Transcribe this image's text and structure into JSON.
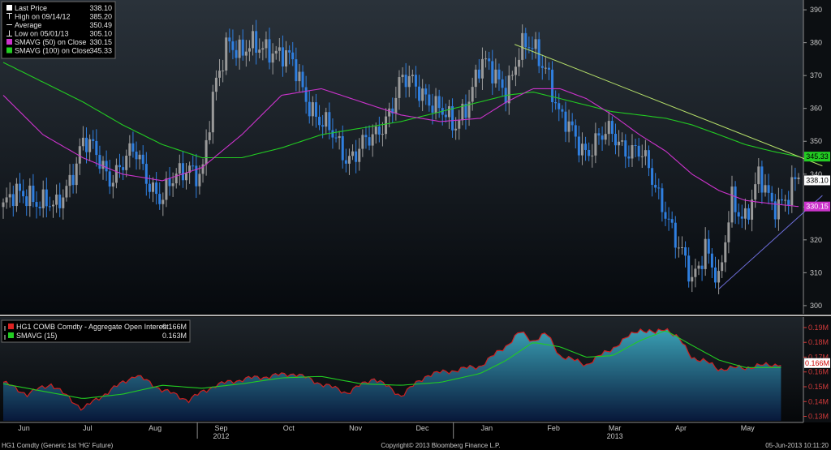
{
  "footer": {
    "left": "HG1 Comdty (Generic 1st 'HG' Future)",
    "center": "Copyright© 2013 Bloomberg Finance L.P.",
    "right": "05-Jun-2013 10:11:20"
  },
  "chart_data": [
    {
      "type": "line",
      "subtype": "candlestick",
      "xlabel": "",
      "ylabel": "",
      "ylim": [
        298,
        392
      ],
      "y_ticks": [
        300,
        310,
        320,
        330,
        340,
        350,
        360,
        370,
        380,
        390
      ],
      "x_ticks": [
        "Jun",
        "Jul",
        "Aug",
        "Sep",
        "Oct",
        "Nov",
        "Dec",
        "Jan",
        "Feb",
        "Mar",
        "Apr",
        "May"
      ],
      "year_labels": [
        "2012",
        "2013"
      ],
      "grid": false,
      "legend_position": "top-left",
      "colors": {
        "up": "#9a9a9a",
        "down": "#2f7fe0",
        "sma50": "#cc33cc",
        "sma100": "#22cc22",
        "trend_down": "#b6e06a",
        "trend_up": "#7070e0"
      },
      "legend": [
        {
          "label": "Last Price",
          "value": "338.10",
          "marker": "white-square"
        },
        {
          "label": "High on 09/14/12",
          "value": "385.20",
          "marker": "high-tick"
        },
        {
          "label": "Average",
          "value": "350.49",
          "marker": "dash"
        },
        {
          "label": "Low on 05/01/13",
          "value": "305.10",
          "marker": "low-tick"
        },
        {
          "label": "SMAVG (50) on Close",
          "value": "330.15",
          "marker": "magenta-square"
        },
        {
          "label": "SMAVG (100) on Close",
          "value": "345.33",
          "marker": "green-square"
        }
      ],
      "badges": [
        {
          "label": "345.33",
          "value": 345.33,
          "bg": "#22cc22",
          "fg": "#000000"
        },
        {
          "label": "338.10",
          "value": 338.1,
          "bg": "#ffffff",
          "fg": "#000000"
        },
        {
          "label": "330.15",
          "value": 330.15,
          "bg": "#cc33cc",
          "fg": "#ffffff"
        }
      ],
      "series": [
        {
          "name": "Last Price",
          "t": [
            0.0,
            0.033,
            0.066,
            0.1,
            0.133,
            0.166,
            0.2,
            0.233,
            0.25,
            0.266,
            0.283,
            0.3,
            0.333,
            0.366,
            0.4,
            0.433,
            0.466,
            0.5,
            0.533,
            0.566,
            0.6,
            0.633,
            0.65,
            0.666,
            0.683,
            0.7,
            0.733,
            0.766,
            0.8,
            0.833,
            0.85,
            0.866,
            0.883,
            0.9,
            0.916,
            0.933,
            0.95,
            0.966,
            1.0
          ],
          "values": [
            330,
            335,
            328,
            350,
            340,
            346,
            332,
            344,
            339,
            365,
            383,
            376,
            380,
            372,
            355,
            346,
            350,
            368,
            365,
            353,
            373,
            367,
            377,
            378,
            374,
            356,
            348,
            352,
            346,
            330,
            316,
            307,
            320,
            305,
            332,
            328,
            338,
            330,
            338.1
          ]
        },
        {
          "name": "SMAVG (50) on Close",
          "t": [
            0.0,
            0.05,
            0.1,
            0.15,
            0.2,
            0.25,
            0.3,
            0.35,
            0.4,
            0.45,
            0.5,
            0.55,
            0.6,
            0.633,
            0.666,
            0.7,
            0.733,
            0.766,
            0.8,
            0.833,
            0.866,
            0.9,
            0.933,
            0.966,
            1.0
          ],
          "values": [
            364,
            352,
            345,
            340,
            338,
            342,
            352,
            364,
            366,
            362,
            358,
            356,
            357,
            362,
            366,
            366,
            363,
            358,
            352,
            347,
            340,
            335,
            332,
            331,
            330.15
          ]
        },
        {
          "name": "SMAVG (100) on Close",
          "t": [
            0.0,
            0.05,
            0.1,
            0.15,
            0.2,
            0.25,
            0.3,
            0.35,
            0.4,
            0.45,
            0.5,
            0.55,
            0.6,
            0.633,
            0.666,
            0.7,
            0.733,
            0.766,
            0.8,
            0.833,
            0.866,
            0.9,
            0.933,
            0.966,
            1.0
          ],
          "values": [
            374,
            368,
            362,
            355,
            349,
            345,
            345,
            348,
            352,
            354,
            356,
            359,
            362,
            364,
            365,
            363,
            361,
            359,
            358,
            357,
            355,
            352,
            349,
            347,
            345.33
          ]
        },
        {
          "name": "Resistance trendline",
          "t": [
            0.643,
            1.03
          ],
          "values": [
            379.5,
            342.5
          ]
        },
        {
          "name": "Support trendline",
          "t": [
            0.9,
            1.03
          ],
          "values": [
            305.1,
            333.5
          ]
        }
      ]
    },
    {
      "type": "area",
      "ylim": [
        0.127,
        0.196
      ],
      "y_ticks": [
        0.13,
        0.14,
        0.15,
        0.16,
        0.17,
        0.18,
        0.19
      ],
      "y_tick_labels": [
        "0.13M",
        "0.14M",
        "0.15M",
        "0.16M",
        "0.17M",
        "0.18M",
        "0.19M"
      ],
      "grid": false,
      "legend_position": "top-left",
      "colors": {
        "area_top": "#2f8fa8",
        "area_bottom": "#0a1c3a",
        "outline": "#d02020",
        "sma": "#22cc22"
      },
      "legend": [
        {
          "label": "HG1 COMB Comdty - Aggregate Open Interest",
          "value": "0.166M",
          "marker": "red-square"
        },
        {
          "label": "SMAVG (15)",
          "value": "0.163M",
          "marker": "green-square"
        }
      ],
      "badges": [
        {
          "label": "0.166M",
          "value": 0.166,
          "bg": "#ffffff",
          "fg": "#cc0000"
        }
      ],
      "series": [
        {
          "name": "Aggregate Open Interest",
          "t": [
            0.0,
            0.03,
            0.06,
            0.1,
            0.13,
            0.166,
            0.2,
            0.233,
            0.266,
            0.3,
            0.333,
            0.366,
            0.4,
            0.433,
            0.466,
            0.5,
            0.533,
            0.566,
            0.6,
            0.633,
            0.65,
            0.666,
            0.683,
            0.7,
            0.733,
            0.766,
            0.8,
            0.82,
            0.833,
            0.85,
            0.866,
            0.883,
            0.9,
            0.933,
            0.966,
            1.0
          ],
          "values": [
            0.153,
            0.145,
            0.152,
            0.135,
            0.146,
            0.158,
            0.148,
            0.141,
            0.151,
            0.155,
            0.157,
            0.159,
            0.152,
            0.146,
            0.156,
            0.144,
            0.158,
            0.161,
            0.164,
            0.178,
            0.187,
            0.181,
            0.186,
            0.171,
            0.165,
            0.176,
            0.189,
            0.186,
            0.19,
            0.182,
            0.17,
            0.167,
            0.162,
            0.163,
            0.165,
            0.166
          ]
        },
        {
          "name": "SMAVG (15)",
          "t": [
            0.0,
            0.05,
            0.1,
            0.15,
            0.2,
            0.25,
            0.3,
            0.35,
            0.4,
            0.45,
            0.5,
            0.55,
            0.6,
            0.633,
            0.666,
            0.7,
            0.733,
            0.766,
            0.8,
            0.833,
            0.866,
            0.9,
            0.933,
            0.966,
            1.0
          ],
          "values": [
            0.152,
            0.147,
            0.142,
            0.145,
            0.151,
            0.149,
            0.152,
            0.156,
            0.157,
            0.152,
            0.151,
            0.153,
            0.159,
            0.168,
            0.18,
            0.177,
            0.17,
            0.171,
            0.181,
            0.188,
            0.178,
            0.168,
            0.163,
            0.163,
            0.163
          ]
        }
      ]
    }
  ]
}
